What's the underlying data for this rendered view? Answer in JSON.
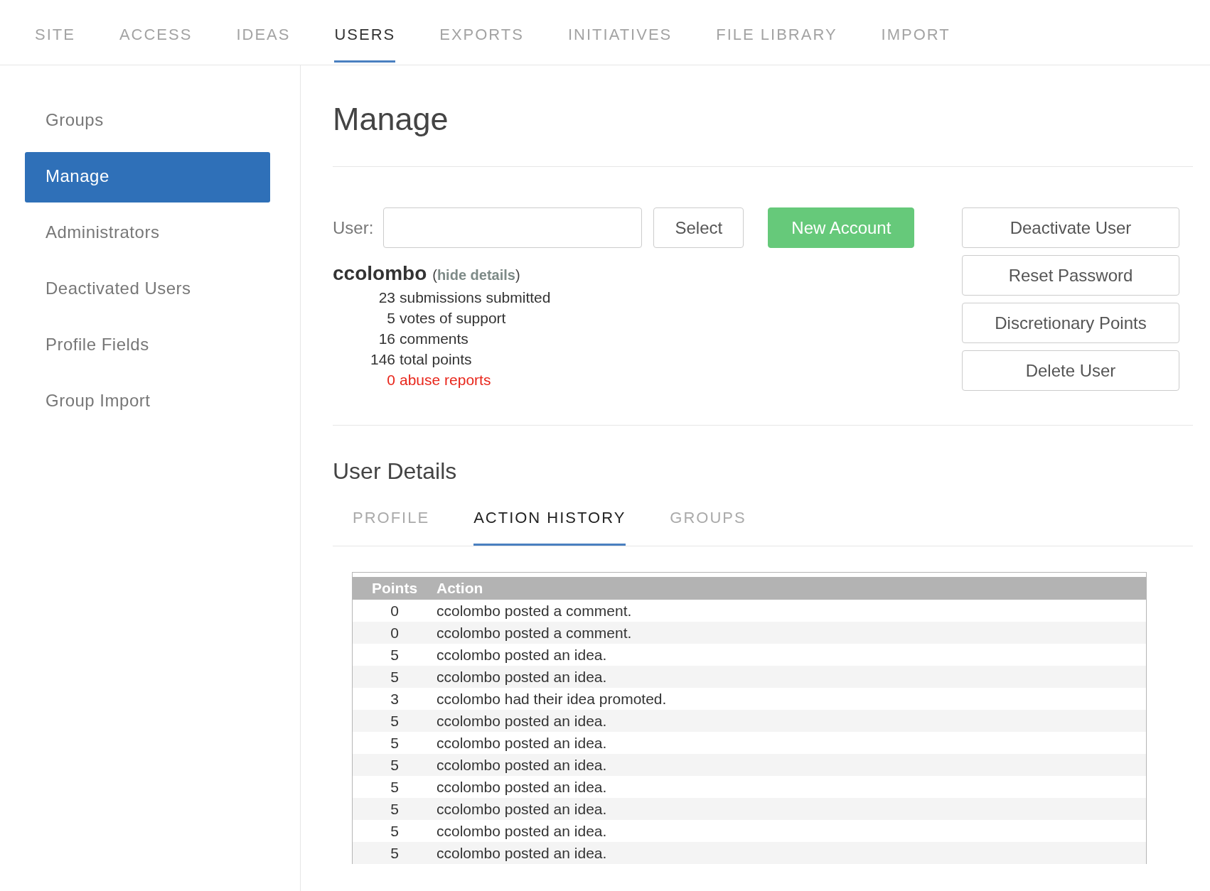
{
  "top_tabs": [
    {
      "label": "SITE",
      "selected": false
    },
    {
      "label": "ACCESS",
      "selected": false
    },
    {
      "label": "IDEAS",
      "selected": false
    },
    {
      "label": "USERS",
      "selected": true
    },
    {
      "label": "EXPORTS",
      "selected": false
    },
    {
      "label": "INITIATIVES",
      "selected": false
    },
    {
      "label": "FILE LIBRARY",
      "selected": false
    },
    {
      "label": "IMPORT",
      "selected": false
    }
  ],
  "sidebar": {
    "items": [
      {
        "label": "Groups",
        "selected": false
      },
      {
        "label": "Manage",
        "selected": true
      },
      {
        "label": "Administrators",
        "selected": false
      },
      {
        "label": "Deactivated Users",
        "selected": false
      },
      {
        "label": "Profile Fields",
        "selected": false
      },
      {
        "label": "Group Import",
        "selected": false
      }
    ]
  },
  "page_title": "Manage",
  "user_form": {
    "label": "User:",
    "select_button": "Select",
    "new_account_button": "New Account"
  },
  "user_summary": {
    "username": "ccolombo",
    "toggle_open": "(",
    "toggle_link": "hide details",
    "toggle_close": ")",
    "stats": [
      {
        "count": "23",
        "label": "submissions submitted",
        "kind": "normal"
      },
      {
        "count": "5",
        "label": "votes of support",
        "kind": "normal"
      },
      {
        "count": "16",
        "label": "comments",
        "kind": "normal"
      },
      {
        "count": "146",
        "label": "total points",
        "kind": "normal"
      },
      {
        "count": "0",
        "label": "abuse reports",
        "kind": "alert"
      }
    ]
  },
  "actions": [
    "Deactivate User",
    "Reset Password",
    "Discretionary Points",
    "Delete User"
  ],
  "details_title": "User Details",
  "detail_tabs": [
    {
      "label": "PROFILE",
      "selected": false
    },
    {
      "label": "ACTION HISTORY",
      "selected": true
    },
    {
      "label": "GROUPS",
      "selected": false
    }
  ],
  "history_table": {
    "columns": [
      "Points",
      "Action"
    ],
    "rows": [
      [
        "0",
        "ccolombo posted a comment."
      ],
      [
        "0",
        "ccolombo posted a comment."
      ],
      [
        "5",
        "ccolombo posted an idea."
      ],
      [
        "5",
        "ccolombo posted an idea."
      ],
      [
        "3",
        "ccolombo had their idea promoted."
      ],
      [
        "5",
        "ccolombo posted an idea."
      ],
      [
        "5",
        "ccolombo posted an idea."
      ],
      [
        "5",
        "ccolombo posted an idea."
      ],
      [
        "5",
        "ccolombo posted an idea."
      ],
      [
        "5",
        "ccolombo posted an idea."
      ],
      [
        "5",
        "ccolombo posted an idea."
      ],
      [
        "5",
        "ccolombo posted an idea."
      ]
    ]
  }
}
